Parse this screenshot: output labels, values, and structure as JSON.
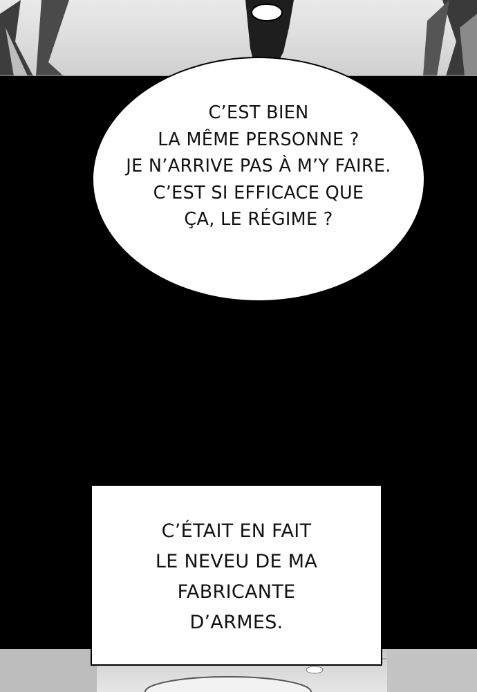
{
  "speech_bubble": {
    "lines": [
      "C’EST BIEN",
      "LA MÊME PERSONNE ?",
      "JE N’ARRIVE PAS À M’Y FAIRE.",
      "C’EST SI EFFICACE QUE",
      "ÇA, LE RÉGIME ?"
    ]
  },
  "caption": {
    "lines": [
      "C’ÉTAIT EN FAIT",
      "LE NEVEU DE MA",
      "FABRICANTE",
      "D’ARMES."
    ]
  },
  "colors": {
    "background": "#000000",
    "bubble": "#ffffff",
    "text": "#111111",
    "art_light": "#e6e6e6",
    "art_dark": "#3a3a3a"
  }
}
